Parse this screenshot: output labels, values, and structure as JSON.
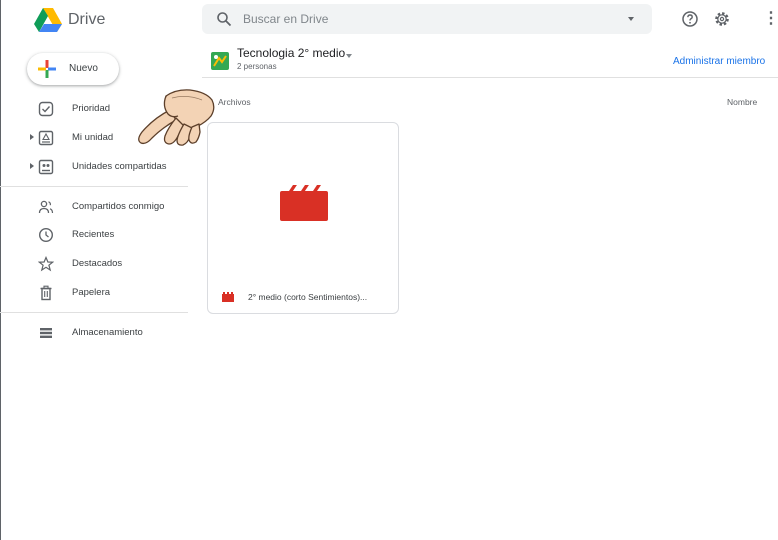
{
  "header": {
    "app_name": "Drive",
    "search_placeholder": "Buscar en Drive",
    "help_icon": "help-circle-icon",
    "settings_icon": "gear-icon",
    "more_icon": "kebab-icon"
  },
  "new_button": {
    "label": "Nuevo"
  },
  "sidebar": {
    "items": [
      {
        "label": "Prioridad",
        "icon": "priority-check-icon"
      },
      {
        "label": "Mi unidad",
        "icon": "my-drive-icon"
      },
      {
        "label": "Unidades compartidas",
        "icon": "shared-drives-icon"
      },
      {
        "label": "Compartidos conmigo",
        "icon": "people-icon"
      },
      {
        "label": "Recientes",
        "icon": "clock-icon"
      },
      {
        "label": "Destacados",
        "icon": "star-icon"
      },
      {
        "label": "Papelera",
        "icon": "trash-icon"
      },
      {
        "label": "Almacenamiento",
        "icon": "storage-icon"
      }
    ]
  },
  "folder": {
    "title": "Tecnologia 2° medio",
    "members": "2 personas",
    "manage_label": "Administrar miembro"
  },
  "content": {
    "section_label": "Archivos",
    "sort_label": "Nombre",
    "files": [
      {
        "name": "2° medio (corto Sentimientos)...",
        "icon": "video-clapper-icon"
      }
    ]
  },
  "colors": {
    "accent": "#1a73e8",
    "video_red": "#d93025",
    "divider": "#e0e0e0"
  }
}
